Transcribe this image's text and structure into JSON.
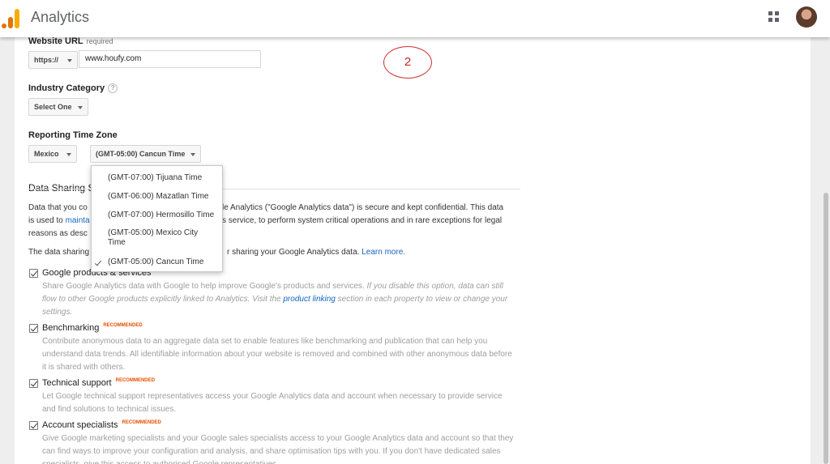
{
  "header": {
    "app_title": "Analytics",
    "apps_icon": "apps-grid-icon",
    "avatar": "user-avatar"
  },
  "website_url": {
    "label": "Website URL",
    "required": "required",
    "protocol": "https://",
    "value": "www.houfy.com"
  },
  "annotation": {
    "number": "2"
  },
  "industry": {
    "label": "Industry Category",
    "help": "?",
    "selected": "Select One"
  },
  "timezone": {
    "label": "Reporting Time Zone",
    "country": "Mexico",
    "selected": "(GMT-05:00) Cancun Time",
    "options": [
      "(GMT-07:00) Tijuana Time",
      "(GMT-06:00) Mazatlan Time",
      "(GMT-07:00) Hermosillo Time",
      "(GMT-05:00) Mexico City Time",
      "(GMT-05:00) Cancun Time"
    ]
  },
  "data_sharing": {
    "title": "Data Sharing S",
    "para1_a": "Data that you co",
    "para1_b": "le Analytics (\"Google Analytics data\") is secure and kept confidential. This data",
    "para1_c": "is used to",
    "para1_link": "mainta",
    "para1_d": "s service, to perform system critical operations and in rare exceptions for legal",
    "para1_e": "reasons as desc",
    "para2_a": "The data sharing",
    "para2_b": "r sharing your Google Analytics data.",
    "learn_more": "Learn more.",
    "recommended": "RECOMMENDED",
    "options": [
      {
        "title": "Google products & services",
        "desc_plain": "Share Google Analytics data with Google to help improve Google's products and services.",
        "desc_italic_a": "If you disable this option, data can still flow to other Google products explicitly linked to Analytics. Visit the",
        "desc_link": "product linking",
        "desc_italic_b": "section in each property to view or change your settings."
      },
      {
        "title": "Benchmarking",
        "desc": "Contribute anonymous data to an aggregate data set to enable features like benchmarking and publication that can help you understand data trends. All identifiable information about your website is removed and combined with other anonymous data before it is shared with others."
      },
      {
        "title": "Technical support",
        "desc": "Let Google technical support representatives access your Google Analytics data and account when necessary to provide service and find solutions to technical issues."
      },
      {
        "title": "Account specialists",
        "desc": "Give Google marketing specialists and your Google sales specialists access to your Google Analytics data and account so that they can find ways to improve your configuration and analysis, and share optimisation tips with you. If you don't have dedicated sales specialists, give this access to authorised Google representatives."
      }
    ]
  }
}
